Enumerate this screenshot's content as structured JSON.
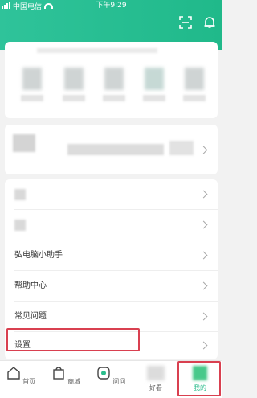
{
  "status_bar": {
    "carrier": "中国电信",
    "time": "下午9:29"
  },
  "header": {
    "scan_icon": "scan-icon",
    "bell_icon": "bell-icon"
  },
  "menu": {
    "assistant": "弘电脑小助手",
    "help": "帮助中心",
    "faq": "常见问题",
    "settings": "设置"
  },
  "tabs": [
    {
      "label": "首页",
      "icon": "home-icon"
    },
    {
      "label": "商城",
      "icon": "shop-bag-icon"
    },
    {
      "label": "问问",
      "icon": "ask-icon"
    },
    {
      "label": "好看",
      "icon": "video-icon"
    },
    {
      "label": "我的",
      "icon": "profile-icon"
    }
  ],
  "colors": {
    "accent": "#20b98a",
    "highlight": "#d94050"
  }
}
